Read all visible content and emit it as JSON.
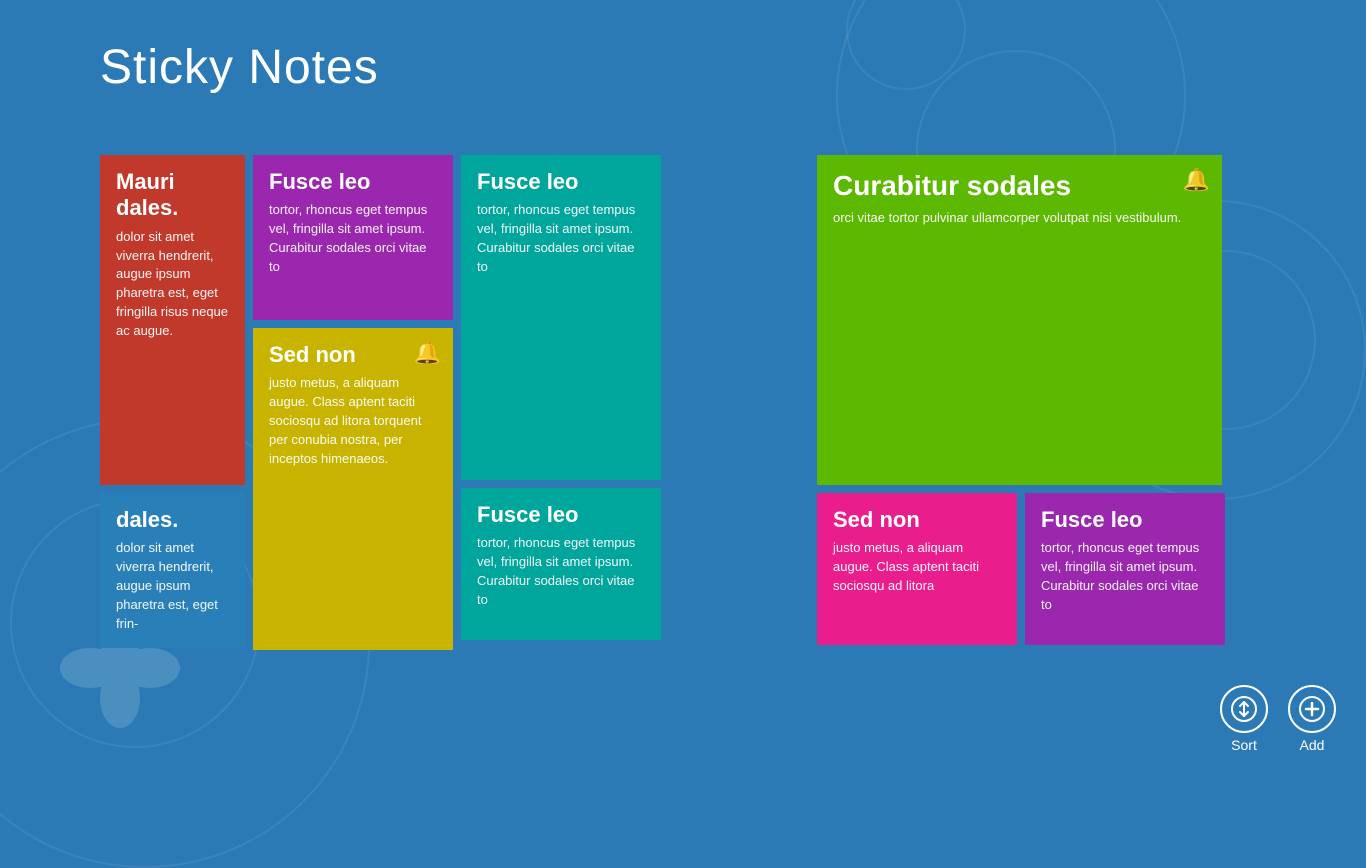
{
  "app": {
    "title": "Sticky Notes"
  },
  "notes": [
    {
      "id": "note1",
      "color": "#c0392b",
      "title": "Mauri dales.",
      "body": "dolor sit amet viverra hendrerit, augue ipsum pharetra est, eget fringilla risus neque ac augue.",
      "has_bell": false,
      "col": 1,
      "size": "large"
    },
    {
      "id": "note2",
      "color": "#2980b9",
      "title": "dales.",
      "body": "dolor sit amet viverra hendrerit, augue ipsum pharetra est, eget frin-",
      "has_bell": false,
      "col": 1,
      "size": "small"
    },
    {
      "id": "note3",
      "color": "#9b27af",
      "title": "Fusce leo",
      "body": "tortor, rhoncus eget tempus vel, fringilla sit amet ipsum. Curabitur sodales orci vitae to",
      "has_bell": false,
      "col": 2,
      "size": "small"
    },
    {
      "id": "note4",
      "color": "#c8b400",
      "title": "Sed non",
      "body": "justo metus, a aliquam augue. Class aptent taciti sociosqu ad litora torquent per conubia nostra, per inceptos himenaeos.",
      "has_bell": true,
      "col": 2,
      "size": "large"
    },
    {
      "id": "note5",
      "color": "#00a69c",
      "title": "Fusce leo",
      "body": "tortor, rhoncus eget tempus vel, fringilla sit amet ipsum. Curabitur sodales orci vitae to",
      "has_bell": false,
      "col": 3,
      "size": "large"
    },
    {
      "id": "note6",
      "color": "#00a69c",
      "title": "Fusce leo",
      "body": "tortor, rhoncus eget tempus vel, fringilla sit amet ipsum. Curabitur sodales orci vitae to",
      "has_bell": false,
      "col": 3,
      "size": "small"
    },
    {
      "id": "note7",
      "color": "#5cb800",
      "title": "Curabitur sodales",
      "body": "orci vitae tortor pulvinar ullamcorper volutpat nisi vestibulum.",
      "has_bell": true,
      "col": 4,
      "size": "large"
    },
    {
      "id": "note8",
      "color": "#e91e8c",
      "title": "Sed non",
      "body": "justo metus, a aliquam augue. Class aptent taciti sociosqu ad litora",
      "has_bell": false,
      "col": 4,
      "size": "small"
    },
    {
      "id": "note9",
      "color": "#9b27af",
      "title": "Fusce leo",
      "body": "tortor, rhoncus eget tempus vel, fringilla sit amet ipsum. Curabitur sodales orci vitae to",
      "has_bell": false,
      "col": 5,
      "size": "small"
    }
  ],
  "actions": {
    "sort_label": "Sort",
    "add_label": "Add"
  }
}
